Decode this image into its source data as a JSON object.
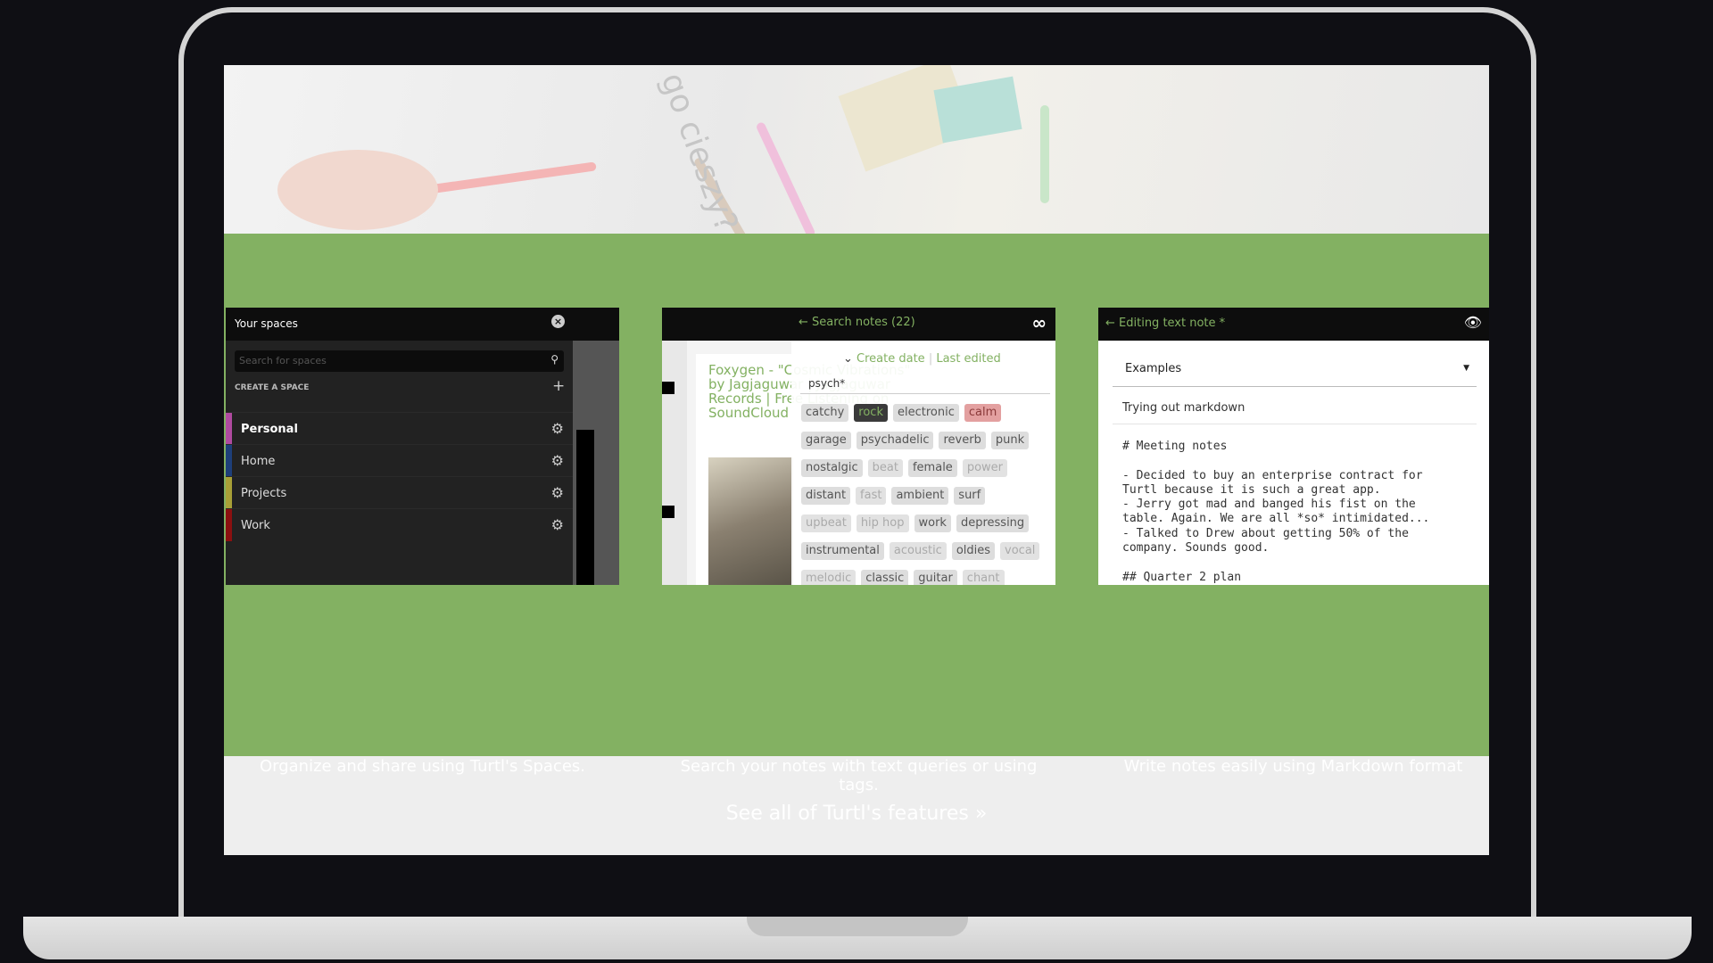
{
  "hero": {
    "handwriting": "Co go cieszy?"
  },
  "colors": {
    "green": "#83b162",
    "header": "#0d0d0d",
    "personal": "#b04aa0",
    "home": "#1e3f7a",
    "projects": "#a8a037",
    "work": "#8b1010"
  },
  "spaces_panel": {
    "title": "Your spaces",
    "close_icon": "close-circle-icon",
    "search_placeholder": "Search for spaces",
    "create_label": "CREATE A SPACE",
    "items": [
      {
        "label": "Personal"
      },
      {
        "label": "Home"
      },
      {
        "label": "Projects"
      },
      {
        "label": "Work"
      }
    ],
    "caption": "Organize and share using Turtl's Spaces."
  },
  "search_panel": {
    "title": "Search notes (22)",
    "sort_create": "Create date",
    "sort_edited": "Last edited",
    "query": "psych*",
    "background_note": "Foxygen - \"Cosmic Vibrations\" by Jagjaguwar | Jagjaguwar Records | Free Listening on SoundCloud",
    "tags": [
      {
        "label": "catchy"
      },
      {
        "label": "rock",
        "state": "active"
      },
      {
        "label": "electronic"
      },
      {
        "label": "calm",
        "state": "red"
      },
      {
        "label": "garage"
      },
      {
        "label": "psychadelic"
      },
      {
        "label": "reverb"
      },
      {
        "label": "punk"
      },
      {
        "label": "nostalgic"
      },
      {
        "label": "beat",
        "state": "faded"
      },
      {
        "label": "female"
      },
      {
        "label": "power",
        "state": "faded"
      },
      {
        "label": "distant"
      },
      {
        "label": "fast",
        "state": "faded"
      },
      {
        "label": "ambient"
      },
      {
        "label": "surf"
      },
      {
        "label": "upbeat",
        "state": "faded"
      },
      {
        "label": "hip hop",
        "state": "faded"
      },
      {
        "label": "work"
      },
      {
        "label": "depressing"
      },
      {
        "label": "instrumental"
      },
      {
        "label": "acoustic",
        "state": "faded"
      },
      {
        "label": "oldies"
      },
      {
        "label": "vocal",
        "state": "faded"
      },
      {
        "label": "melodic",
        "state": "faded"
      },
      {
        "label": "classic"
      },
      {
        "label": "guitar"
      },
      {
        "label": "chant",
        "state": "faded"
      }
    ],
    "caption": "Search your notes with text queries or using tags."
  },
  "editor_panel": {
    "title": "Editing text note *",
    "space_select": "Examples",
    "note_title": "Trying out markdown",
    "body": "# Meeting notes\n\n- Decided to buy an enterprise contract for\nTurtl because it is such a great app.\n- Jerry got mad and banged his fist on the\ntable. Again. We are all *so* intimidated...\n- Talked to Drew about getting 50% of the\ncompany. Sounds good.\n\n## Quarter 2 plan",
    "caption": "Write notes easily using Markdown format"
  },
  "features_link": "See all of Turtl's features »"
}
